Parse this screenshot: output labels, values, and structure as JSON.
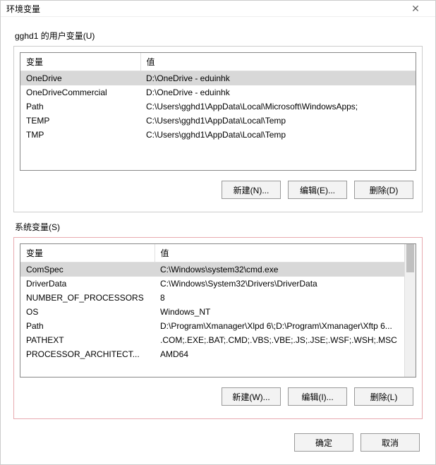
{
  "window": {
    "title": "环境变量",
    "close": "✕"
  },
  "user": {
    "label": "gghd1 的用户变量(U)",
    "headers": {
      "name": "变量",
      "value": "值"
    },
    "rows": [
      {
        "name": "OneDrive",
        "value": "D:\\OneDrive - eduinhk",
        "selected": true
      },
      {
        "name": "OneDriveCommercial",
        "value": "D:\\OneDrive - eduinhk",
        "selected": false
      },
      {
        "name": "Path",
        "value": "C:\\Users\\gghd1\\AppData\\Local\\Microsoft\\WindowsApps;",
        "selected": false
      },
      {
        "name": "TEMP",
        "value": "C:\\Users\\gghd1\\AppData\\Local\\Temp",
        "selected": false
      },
      {
        "name": "TMP",
        "value": "C:\\Users\\gghd1\\AppData\\Local\\Temp",
        "selected": false
      }
    ],
    "buttons": {
      "new": "新建(N)...",
      "edit": "编辑(E)...",
      "delete": "删除(D)"
    }
  },
  "sys": {
    "label": "系统变量(S)",
    "headers": {
      "name": "变量",
      "value": "值"
    },
    "rows": [
      {
        "name": "ComSpec",
        "value": "C:\\Windows\\system32\\cmd.exe",
        "selected": true
      },
      {
        "name": "DriverData",
        "value": "C:\\Windows\\System32\\Drivers\\DriverData",
        "selected": false
      },
      {
        "name": "NUMBER_OF_PROCESSORS",
        "value": "8",
        "selected": false
      },
      {
        "name": "OS",
        "value": "Windows_NT",
        "selected": false
      },
      {
        "name": "Path",
        "value": "D:\\Program\\Xmanager\\Xlpd 6\\;D:\\Program\\Xmanager\\Xftp 6...",
        "selected": false
      },
      {
        "name": "PATHEXT",
        "value": ".COM;.EXE;.BAT;.CMD;.VBS;.VBE;.JS;.JSE;.WSF;.WSH;.MSC",
        "selected": false
      },
      {
        "name": "PROCESSOR_ARCHITECT...",
        "value": "AMD64",
        "selected": false
      }
    ],
    "buttons": {
      "new": "新建(W)...",
      "edit": "编辑(I)...",
      "delete": "删除(L)"
    }
  },
  "footer": {
    "ok": "确定",
    "cancel": "取消"
  }
}
